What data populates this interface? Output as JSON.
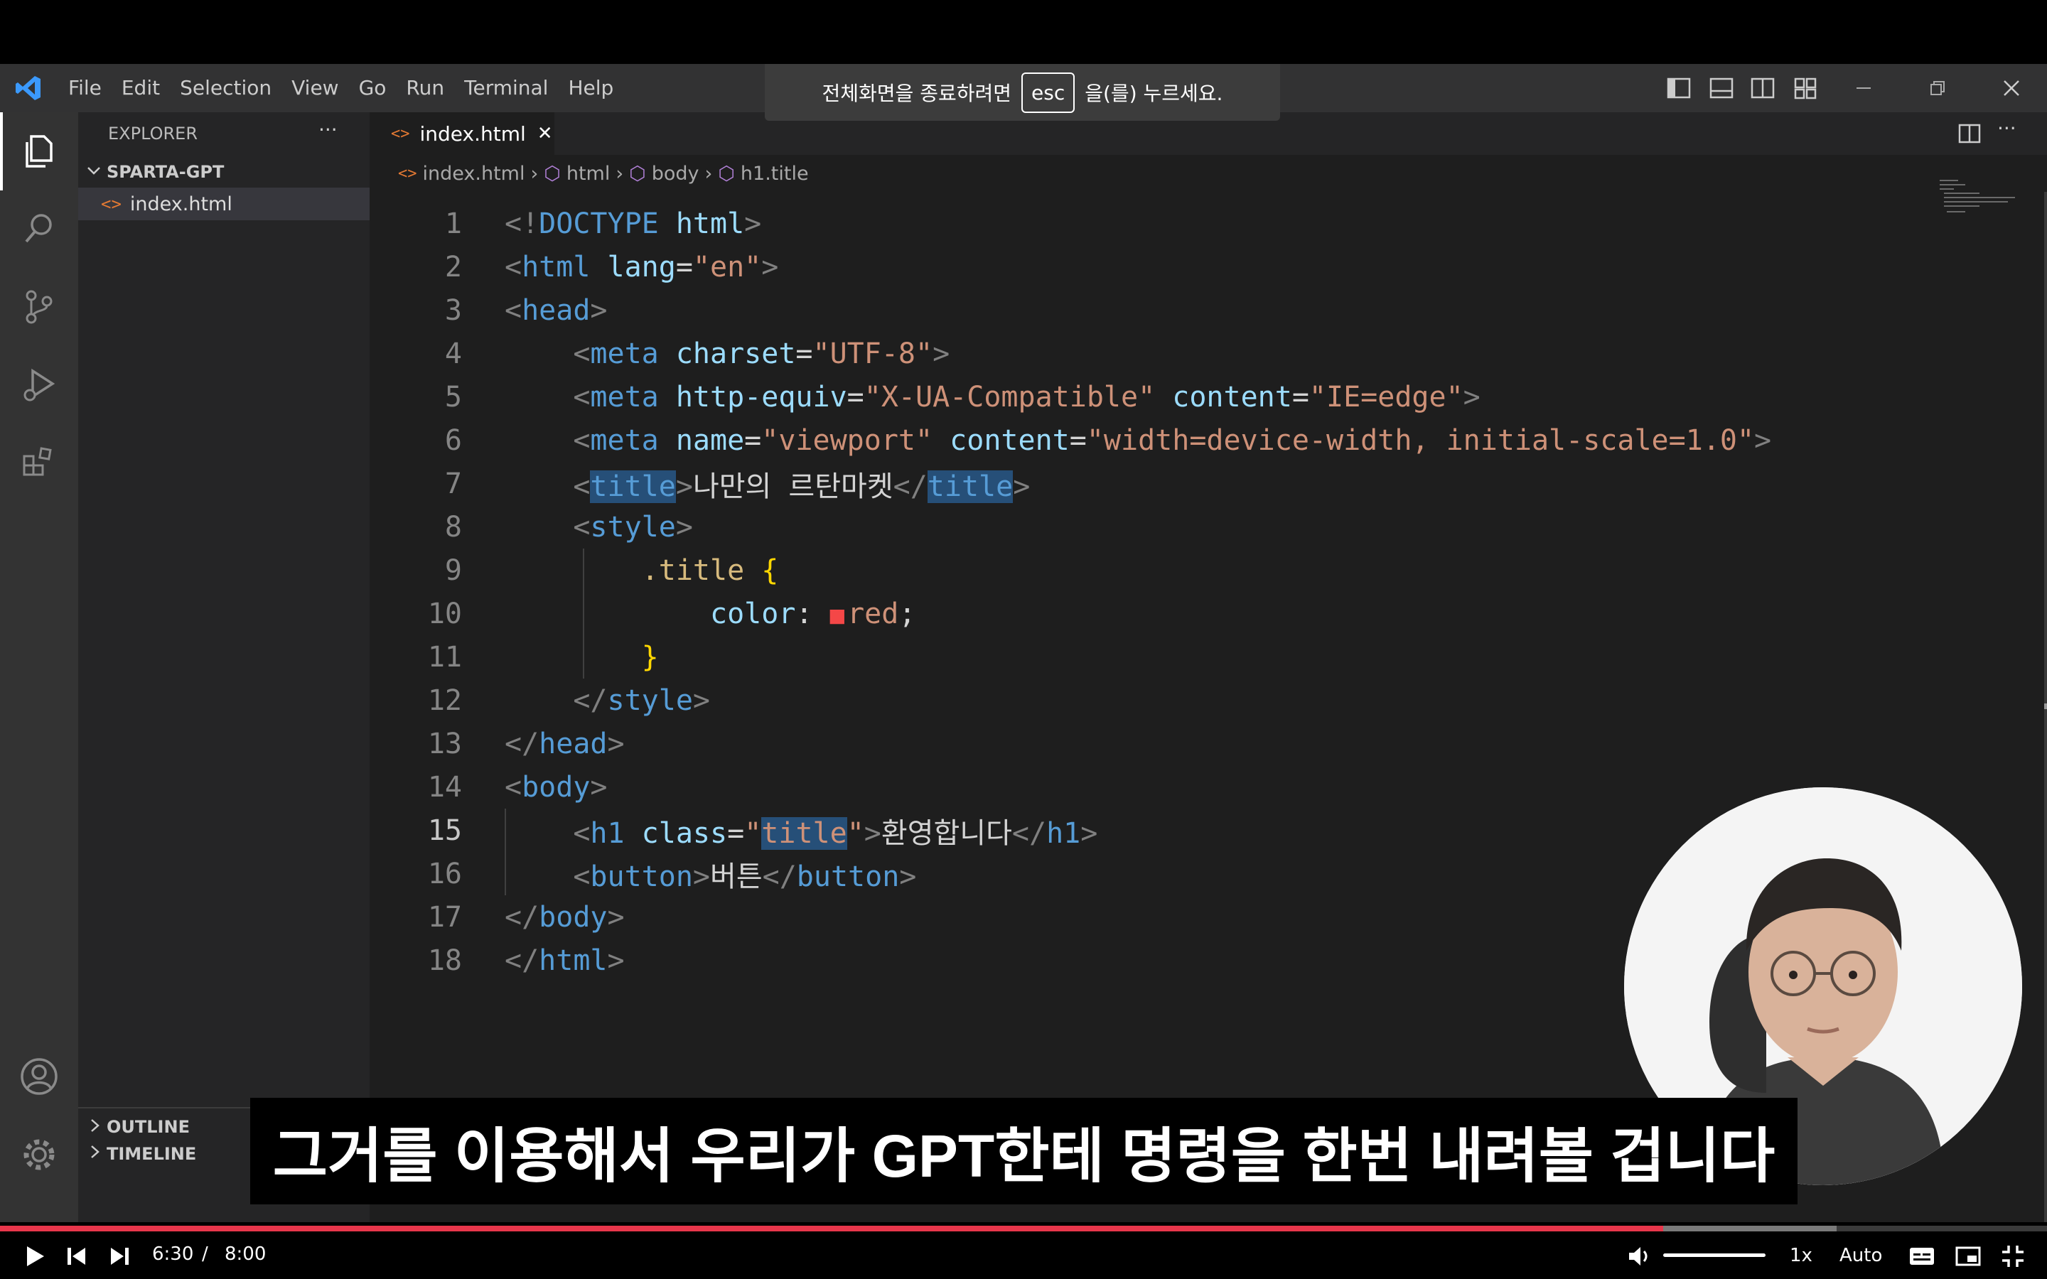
{
  "fullscreen_hint": {
    "before": "전체화면을 종료하려면",
    "key": "esc",
    "after": "을(를) 누르세요."
  },
  "menu": [
    "File",
    "Edit",
    "Selection",
    "View",
    "Go",
    "Run",
    "Terminal",
    "Help"
  ],
  "explorer": {
    "header": "EXPLORER",
    "more": "···",
    "folder": "SPARTA-GPT",
    "files": [
      "index.html"
    ],
    "sections": [
      "OUTLINE",
      "TIMELINE"
    ]
  },
  "tab": {
    "label": "index.html",
    "close": "✕"
  },
  "breadcrumb": [
    "index.html",
    "html",
    "body",
    "h1.title"
  ],
  "code_lines": [
    {
      "n": "1",
      "tokens": [
        {
          "t": "<!",
          "c": "t-punc"
        },
        {
          "t": "DOCTYPE ",
          "c": "t-tag"
        },
        {
          "t": "html",
          "c": "t-attr"
        },
        {
          "t": ">",
          "c": "t-punc"
        }
      ]
    },
    {
      "n": "2",
      "tokens": [
        {
          "t": "<",
          "c": "t-punc"
        },
        {
          "t": "html ",
          "c": "t-tag"
        },
        {
          "t": "lang",
          "c": "t-attr"
        },
        {
          "t": "=",
          "c": "t-txt"
        },
        {
          "t": "\"en\"",
          "c": "t-str"
        },
        {
          "t": ">",
          "c": "t-punc"
        }
      ]
    },
    {
      "n": "3",
      "tokens": [
        {
          "t": "<",
          "c": "t-punc"
        },
        {
          "t": "head",
          "c": "t-tag"
        },
        {
          "t": ">",
          "c": "t-punc"
        }
      ]
    },
    {
      "n": "4",
      "tokens": [
        {
          "t": "    <",
          "c": "t-punc"
        },
        {
          "t": "meta ",
          "c": "t-tag"
        },
        {
          "t": "charset",
          "c": "t-attr"
        },
        {
          "t": "=",
          "c": "t-txt"
        },
        {
          "t": "\"UTF-8\"",
          "c": "t-str"
        },
        {
          "t": ">",
          "c": "t-punc"
        }
      ]
    },
    {
      "n": "5",
      "tokens": [
        {
          "t": "    <",
          "c": "t-punc"
        },
        {
          "t": "meta ",
          "c": "t-tag"
        },
        {
          "t": "http-equiv",
          "c": "t-attr"
        },
        {
          "t": "=",
          "c": "t-txt"
        },
        {
          "t": "\"X-UA-Compatible\" ",
          "c": "t-str"
        },
        {
          "t": "content",
          "c": "t-attr"
        },
        {
          "t": "=",
          "c": "t-txt"
        },
        {
          "t": "\"IE=edge\"",
          "c": "t-str"
        },
        {
          "t": ">",
          "c": "t-punc"
        }
      ]
    },
    {
      "n": "6",
      "tokens": [
        {
          "t": "    <",
          "c": "t-punc"
        },
        {
          "t": "meta ",
          "c": "t-tag"
        },
        {
          "t": "name",
          "c": "t-attr"
        },
        {
          "t": "=",
          "c": "t-txt"
        },
        {
          "t": "\"viewport\" ",
          "c": "t-str"
        },
        {
          "t": "content",
          "c": "t-attr"
        },
        {
          "t": "=",
          "c": "t-txt"
        },
        {
          "t": "\"width=device-width, initial-scale=1.0\"",
          "c": "t-str"
        },
        {
          "t": ">",
          "c": "t-punc"
        }
      ]
    },
    {
      "n": "7",
      "tokens": [
        {
          "t": "    <",
          "c": "t-punc"
        },
        {
          "t": "title",
          "c": "t-tag hl"
        },
        {
          "t": ">",
          "c": "t-punc"
        },
        {
          "t": "나만의 르탄마켓",
          "c": "t-txt"
        },
        {
          "t": "</",
          "c": "t-punc"
        },
        {
          "t": "title",
          "c": "t-tag hl"
        },
        {
          "t": ">",
          "c": "t-punc"
        }
      ]
    },
    {
      "n": "8",
      "tokens": [
        {
          "t": "    <",
          "c": "t-punc"
        },
        {
          "t": "style",
          "c": "t-tag"
        },
        {
          "t": ">",
          "c": "t-punc"
        }
      ]
    },
    {
      "n": "9",
      "tokens": [
        {
          "t": "        ",
          "c": "t-txt"
        },
        {
          "t": ".title",
          "c": "t-sel"
        },
        {
          "t": " ",
          "c": "t-txt"
        },
        {
          "t": "{",
          "c": "t-brace"
        }
      ]
    },
    {
      "n": "10",
      "tokens": [
        {
          "t": "            ",
          "c": "t-txt"
        },
        {
          "t": "color",
          "c": "t-prop"
        },
        {
          "t": ": ",
          "c": "t-txt"
        },
        {
          "t": "■",
          "c": "swatch"
        },
        {
          "t": "red",
          "c": "t-str"
        },
        {
          "t": ";",
          "c": "t-txt"
        }
      ]
    },
    {
      "n": "11",
      "tokens": [
        {
          "t": "        ",
          "c": "t-txt"
        },
        {
          "t": "}",
          "c": "t-brace"
        }
      ]
    },
    {
      "n": "12",
      "tokens": [
        {
          "t": "    </",
          "c": "t-punc"
        },
        {
          "t": "style",
          "c": "t-tag"
        },
        {
          "t": ">",
          "c": "t-punc"
        }
      ]
    },
    {
      "n": "13",
      "tokens": [
        {
          "t": "</",
          "c": "t-punc"
        },
        {
          "t": "head",
          "c": "t-tag"
        },
        {
          "t": ">",
          "c": "t-punc"
        }
      ]
    },
    {
      "n": "14",
      "tokens": [
        {
          "t": "<",
          "c": "t-punc"
        },
        {
          "t": "body",
          "c": "t-tag"
        },
        {
          "t": ">",
          "c": "t-punc"
        }
      ]
    },
    {
      "n": "15",
      "tokens": [
        {
          "t": "    <",
          "c": "t-punc"
        },
        {
          "t": "h1 ",
          "c": "t-tag"
        },
        {
          "t": "class",
          "c": "t-attr"
        },
        {
          "t": "=",
          "c": "t-txt"
        },
        {
          "t": "\"",
          "c": "t-str"
        },
        {
          "t": "title",
          "c": "t-str hl"
        },
        {
          "t": "\"",
          "c": "t-str"
        },
        {
          "t": ">",
          "c": "t-punc"
        },
        {
          "t": "환영합니다",
          "c": "t-txt"
        },
        {
          "t": "</",
          "c": "t-punc"
        },
        {
          "t": "h1",
          "c": "t-tag"
        },
        {
          "t": ">",
          "c": "t-punc"
        }
      ]
    },
    {
      "n": "16",
      "tokens": [
        {
          "t": "    <",
          "c": "t-punc"
        },
        {
          "t": "button",
          "c": "t-tag"
        },
        {
          "t": ">",
          "c": "t-punc"
        },
        {
          "t": "버튼",
          "c": "t-txt"
        },
        {
          "t": "</",
          "c": "t-punc"
        },
        {
          "t": "button",
          "c": "t-tag"
        },
        {
          "t": ">",
          "c": "t-punc"
        }
      ]
    },
    {
      "n": "17",
      "tokens": [
        {
          "t": "</",
          "c": "t-punc"
        },
        {
          "t": "body",
          "c": "t-tag"
        },
        {
          "t": ">",
          "c": "t-punc"
        }
      ]
    },
    {
      "n": "18",
      "tokens": [
        {
          "t": "</",
          "c": "t-punc"
        },
        {
          "t": "html",
          "c": "t-tag"
        },
        {
          "t": ">",
          "c": "t-punc"
        }
      ]
    }
  ],
  "caption": "그거를 이용해서 우리가 GPT한테 명령을 한번 내려볼 겁니다",
  "player": {
    "current_time": "6:30",
    "separator": "/",
    "duration": "8:00",
    "progress_fraction": 0.8125,
    "speed": "1x",
    "quality": "Auto"
  },
  "colors": {
    "progress": "#e8364b",
    "vscode_accent": "#3b99fc"
  }
}
